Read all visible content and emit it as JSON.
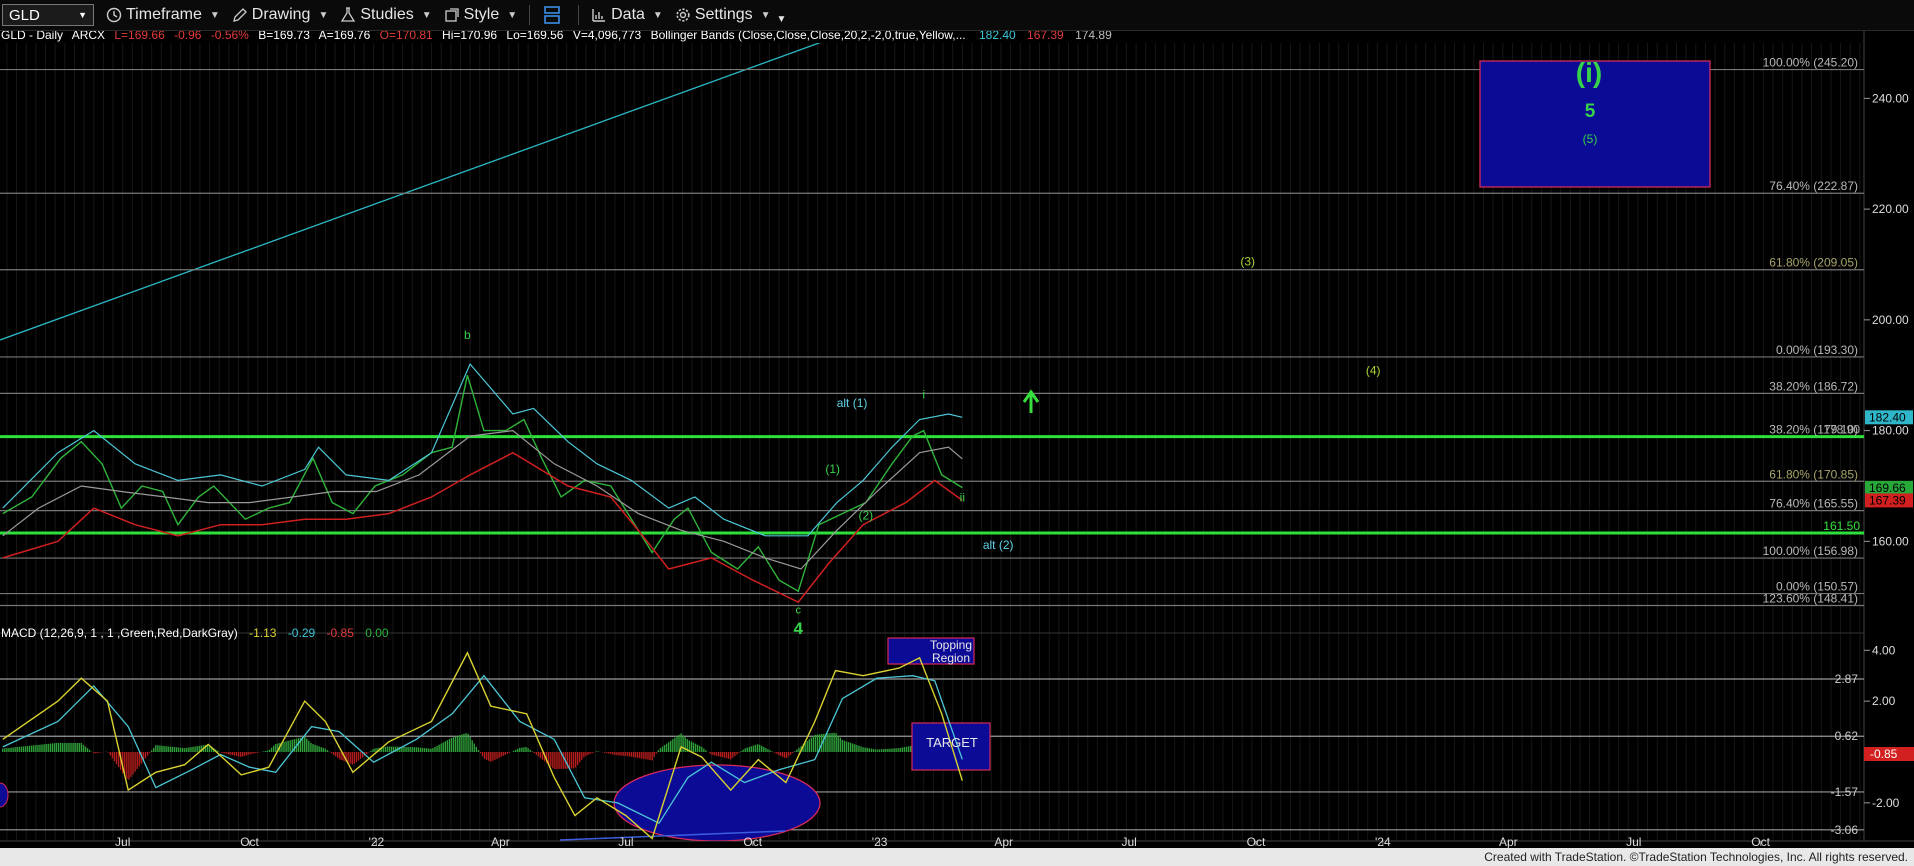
{
  "toolbar": {
    "symbol": "GLD",
    "timeframe": "Timeframe",
    "drawing": "Drawing",
    "studies": "Studies",
    "style": "Style",
    "data": "Data",
    "settings": "Settings"
  },
  "price_panel": {
    "header": {
      "symbol": "GLD - Daily",
      "exchange": "ARCX",
      "last": "L=169.66",
      "change": "-0.96",
      "change_pct": "-0.56%",
      "bid": "B=169.73",
      "ask": "A=169.76",
      "open": "O=170.81",
      "high": "Hi=170.96",
      "low": "Lo=169.56",
      "volume": "V=4,096,773",
      "bb_label": "Bollinger Bands (Close,Close,Close,20,2,-2,0,true,Yellow,...",
      "bb_upper": "182.40",
      "bb_lower": "167.39",
      "bb_mid": "174.89"
    },
    "fib_labels": [
      {
        "text": "100.00% (245.20)",
        "y": 245.2
      },
      {
        "text": "76.40% (222.87)",
        "y": 222.87
      },
      {
        "text": "61.80% (209.05)",
        "y": 209.05
      },
      {
        "text": "0.00% (193.30)",
        "y": 193.3
      },
      {
        "text": "38.20% (186.72)",
        "y": 186.72
      },
      {
        "text": "38.20% (179.10)",
        "y": 178.9
      },
      {
        "text": "61.80% (170.85)",
        "y": 170.85
      },
      {
        "text": "76.40% (165.55)",
        "y": 165.55
      },
      {
        "text": "100.00% (156.98)",
        "y": 156.98
      },
      {
        "text": "0.00% (150.57)",
        "y": 150.57
      },
      {
        "text": "123.60% (148.41)",
        "y": 148.41
      }
    ],
    "support_lines": [
      {
        "text": "178.90",
        "y": 178.9
      },
      {
        "text": "161.50",
        "y": 161.5
      }
    ],
    "axis": {
      "ymin": 142,
      "ymax": 250,
      "ticks": [
        160,
        180,
        200,
        220,
        240
      ]
    },
    "price_tags": [
      {
        "text": "182.40",
        "y": 182.4,
        "bg": "#2fb6c8"
      },
      {
        "text": "169.66",
        "y": 169.66,
        "bg": "#29a83a"
      },
      {
        "text": "167.39",
        "y": 167.39,
        "bg": "#d21f1f"
      }
    ],
    "wave_labels": [
      {
        "text": "b",
        "x": "2022-03-08",
        "y": 196.5,
        "color": "#36d24a",
        "size": 12
      },
      {
        "text": "alt (1)",
        "x": "2022-12-12",
        "y": 184.3,
        "color": "#5fd3e6",
        "size": 12
      },
      {
        "text": "i",
        "x": "2023-02-02",
        "y": 185.8,
        "color": "#36d24a",
        "size": 12
      },
      {
        "text": "(1)",
        "x": "2022-11-28",
        "y": 172.3,
        "color": "#36d24a",
        "size": 12
      },
      {
        "text": "(2)",
        "x": "2022-12-22",
        "y": 163.9,
        "color": "#36d24a",
        "size": 12
      },
      {
        "text": "ii",
        "x": "2023-03-02",
        "y": 167.2,
        "color": "#36d24a",
        "size": 12
      },
      {
        "text": "alt (2)",
        "x": "2023-03-28",
        "y": 158.6,
        "color": "#5fd3e6",
        "size": 12
      },
      {
        "text": "c",
        "x": "2022-11-03",
        "y": 147.0,
        "color": "#36d24a",
        "size": 11
      },
      {
        "text": "4",
        "x": "2022-11-03",
        "y": 143.3,
        "color": "#36d24a",
        "size": 17
      },
      {
        "text": "(3)",
        "x": "2023-09-25",
        "y": 209.8,
        "color": "#a9d232",
        "size": 12
      },
      {
        "text": "(4)",
        "x": "2023-12-25",
        "y": 190.1,
        "color": "#a9d232",
        "size": 12
      }
    ],
    "target_box": {
      "label_top": "(i)",
      "label_mid": "5",
      "label_bottom": "(5)"
    }
  },
  "macd_panel": {
    "header": {
      "label": "MACD (12,26,9, 1 , 1 ,Green,Red,DarkGray)",
      "macd": "-1.13",
      "signal": "-0.29",
      "hist": "-0.85",
      "zero": "0.00"
    },
    "axis": {
      "ymin": -3.5,
      "ymax": 4.6,
      "ticks": [
        4.0,
        2.0,
        0.0,
        -2.0
      ]
    },
    "level_lines": [
      {
        "text": "2.87",
        "y": 2.87
      },
      {
        "text": "0.62",
        "y": 0.62
      },
      {
        "text": "-1.57",
        "y": -1.57
      },
      {
        "text": "-3.06",
        "y": -3.06
      }
    ],
    "value_tag": "-0.85",
    "topping_label": "Topping Region",
    "target_label": "TARGET"
  },
  "time_axis": [
    {
      "text": "Jul",
      "x": "2021-07-01"
    },
    {
      "text": "Oct",
      "x": "2021-10-01"
    },
    {
      "text": "'22",
      "x": "2022-01-01"
    },
    {
      "text": "Apr",
      "x": "2022-04-01"
    },
    {
      "text": "Jul",
      "x": "2022-07-01"
    },
    {
      "text": "Oct",
      "x": "2022-10-01"
    },
    {
      "text": "'23",
      "x": "2023-01-01"
    },
    {
      "text": "Apr",
      "x": "2023-04-01"
    },
    {
      "text": "Jul",
      "x": "2023-07-01"
    },
    {
      "text": "Oct",
      "x": "2023-10-01"
    },
    {
      "text": "'24",
      "x": "2024-01-01"
    },
    {
      "text": "Apr",
      "x": "2024-04-01"
    },
    {
      "text": "Jul",
      "x": "2024-07-01"
    },
    {
      "text": "Oct",
      "x": "2024-10-01"
    }
  ],
  "chart_data": {
    "type": "line",
    "x_domain": [
      "2021-04-03",
      "2024-12-15"
    ],
    "series": [
      {
        "values": [
          [
            "2021-04-05",
            165
          ],
          [
            "2021-04-26",
            168
          ],
          [
            "2021-05-17",
            175
          ],
          [
            "2021-06-01",
            178
          ],
          [
            "2021-06-16",
            174
          ],
          [
            "2021-06-30",
            166
          ],
          [
            "2021-07-15",
            170
          ],
          [
            "2021-07-30",
            169
          ],
          [
            "2021-08-10",
            163
          ],
          [
            "2021-08-25",
            168
          ],
          [
            "2021-09-05",
            170
          ],
          [
            "2021-09-28",
            164
          ],
          [
            "2021-10-15",
            166
          ],
          [
            "2021-10-30",
            167
          ],
          [
            "2021-11-16",
            175
          ],
          [
            "2021-11-30",
            167
          ],
          [
            "2021-12-15",
            165
          ],
          [
            "2021-12-31",
            170
          ],
          [
            "2022-01-20",
            172
          ],
          [
            "2022-02-10",
            176
          ],
          [
            "2022-02-25",
            177
          ],
          [
            "2022-03-08",
            190
          ],
          [
            "2022-03-20",
            180
          ],
          [
            "2022-04-05",
            180
          ],
          [
            "2022-04-18",
            182
          ],
          [
            "2022-05-01",
            175
          ],
          [
            "2022-05-15",
            168
          ],
          [
            "2022-06-01",
            171
          ],
          [
            "2022-06-20",
            170
          ],
          [
            "2022-07-05",
            164
          ],
          [
            "2022-07-20",
            158
          ],
          [
            "2022-08-05",
            164
          ],
          [
            "2022-08-15",
            166
          ],
          [
            "2022-09-01",
            158
          ],
          [
            "2022-09-20",
            155
          ],
          [
            "2022-10-05",
            159
          ],
          [
            "2022-10-20",
            153
          ],
          [
            "2022-11-03",
            151
          ],
          [
            "2022-11-18",
            163
          ],
          [
            "2022-12-05",
            165
          ],
          [
            "2022-12-22",
            167
          ],
          [
            "2023-01-10",
            174
          ],
          [
            "2023-01-25",
            179
          ],
          [
            "2023-02-02",
            180
          ],
          [
            "2023-02-15",
            172
          ],
          [
            "2023-03-02",
            169.7
          ]
        ]
      },
      {
        "values": [
          [
            "2021-04-05",
            161
          ],
          [
            "2021-05-01",
            166
          ],
          [
            "2021-06-01",
            170
          ],
          [
            "2021-06-30",
            169
          ],
          [
            "2021-08-01",
            168
          ],
          [
            "2021-09-01",
            167
          ],
          [
            "2021-10-01",
            167
          ],
          [
            "2021-11-01",
            168
          ],
          [
            "2021-12-01",
            169
          ],
          [
            "2022-01-01",
            169
          ],
          [
            "2022-02-01",
            172
          ],
          [
            "2022-03-10",
            179
          ],
          [
            "2022-04-10",
            180
          ],
          [
            "2022-05-10",
            174
          ],
          [
            "2022-06-10",
            170
          ],
          [
            "2022-07-10",
            165
          ],
          [
            "2022-08-10",
            162
          ],
          [
            "2022-09-10",
            160
          ],
          [
            "2022-10-10",
            157
          ],
          [
            "2022-11-05",
            155
          ],
          [
            "2022-12-01",
            162
          ],
          [
            "2022-12-30",
            169
          ],
          [
            "2023-01-30",
            176
          ],
          [
            "2023-02-20",
            177
          ],
          [
            "2023-03-02",
            174.9
          ]
        ]
      },
      {
        "values": [
          [
            "2021-04-05",
            166
          ],
          [
            "2021-05-15",
            176
          ],
          [
            "2021-06-10",
            180
          ],
          [
            "2021-07-10",
            174
          ],
          [
            "2021-08-10",
            171
          ],
          [
            "2021-09-10",
            172
          ],
          [
            "2021-10-10",
            170
          ],
          [
            "2021-11-10",
            173
          ],
          [
            "2021-11-20",
            177
          ],
          [
            "2021-12-10",
            172
          ],
          [
            "2022-01-10",
            171
          ],
          [
            "2022-02-10",
            176
          ],
          [
            "2022-03-10",
            192
          ],
          [
            "2022-04-10",
            183
          ],
          [
            "2022-04-25",
            184
          ],
          [
            "2022-05-20",
            178
          ],
          [
            "2022-06-10",
            174
          ],
          [
            "2022-07-05",
            171
          ],
          [
            "2022-08-01",
            166
          ],
          [
            "2022-08-20",
            168
          ],
          [
            "2022-09-10",
            164
          ],
          [
            "2022-10-10",
            161
          ],
          [
            "2022-11-10",
            161
          ],
          [
            "2022-12-01",
            167
          ],
          [
            "2022-12-20",
            171
          ],
          [
            "2023-01-10",
            177
          ],
          [
            "2023-01-30",
            182
          ],
          [
            "2023-02-20",
            183
          ],
          [
            "2023-03-02",
            182.4
          ]
        ]
      },
      {
        "values": [
          [
            "2021-04-05",
            157
          ],
          [
            "2021-05-15",
            160
          ],
          [
            "2021-06-10",
            166
          ],
          [
            "2021-07-10",
            163
          ],
          [
            "2021-08-10",
            161
          ],
          [
            "2021-09-10",
            163
          ],
          [
            "2021-10-10",
            163
          ],
          [
            "2021-11-10",
            164
          ],
          [
            "2021-12-10",
            164
          ],
          [
            "2022-01-10",
            165
          ],
          [
            "2022-02-10",
            168
          ],
          [
            "2022-03-10",
            172
          ],
          [
            "2022-04-10",
            176
          ],
          [
            "2022-05-20",
            170
          ],
          [
            "2022-06-20",
            168
          ],
          [
            "2022-07-10",
            162
          ],
          [
            "2022-08-01",
            155
          ],
          [
            "2022-09-01",
            157
          ],
          [
            "2022-10-01",
            153
          ],
          [
            "2022-11-03",
            149
          ],
          [
            "2022-11-25",
            156
          ],
          [
            "2022-12-20",
            163
          ],
          [
            "2023-01-20",
            167
          ],
          [
            "2023-02-10",
            171
          ],
          [
            "2023-03-02",
            167.39
          ]
        ]
      },
      {
        "values": [
          [
            "2021-04-05",
            0.5
          ],
          [
            "2021-05-15",
            2.0
          ],
          [
            "2021-06-01",
            2.9
          ],
          [
            "2021-06-20",
            2.0
          ],
          [
            "2021-07-05",
            -1.5
          ],
          [
            "2021-07-25",
            -0.8
          ],
          [
            "2021-08-15",
            -0.5
          ],
          [
            "2021-09-01",
            0.3
          ],
          [
            "2021-09-25",
            -0.9
          ],
          [
            "2021-10-15",
            -0.6
          ],
          [
            "2021-11-10",
            2.0
          ],
          [
            "2021-11-25",
            1.2
          ],
          [
            "2021-12-15",
            -0.8
          ],
          [
            "2022-01-10",
            0.4
          ],
          [
            "2022-02-10",
            1.2
          ],
          [
            "2022-03-08",
            3.9
          ],
          [
            "2022-03-25",
            1.8
          ],
          [
            "2022-04-20",
            1.5
          ],
          [
            "2022-05-10",
            -1.0
          ],
          [
            "2022-05-25",
            -2.5
          ],
          [
            "2022-06-10",
            -1.8
          ],
          [
            "2022-07-01",
            -2.5
          ],
          [
            "2022-07-20",
            -3.4
          ],
          [
            "2022-08-10",
            0.2
          ],
          [
            "2022-08-25",
            -0.2
          ],
          [
            "2022-09-15",
            -1.5
          ],
          [
            "2022-10-05",
            -0.3
          ],
          [
            "2022-10-25",
            -1.2
          ],
          [
            "2022-11-15",
            1.2
          ],
          [
            "2022-11-30",
            3.2
          ],
          [
            "2022-12-20",
            3.0
          ],
          [
            "2023-01-15",
            3.3
          ],
          [
            "2023-01-30",
            3.7
          ],
          [
            "2023-02-15",
            1.5
          ],
          [
            "2023-03-02",
            -1.13
          ]
        ]
      },
      {
        "values": [
          [
            "2021-04-05",
            0.2
          ],
          [
            "2021-05-15",
            1.2
          ],
          [
            "2021-06-10",
            2.6
          ],
          [
            "2021-07-05",
            1.0
          ],
          [
            "2021-07-25",
            -1.4
          ],
          [
            "2021-08-20",
            -0.7
          ],
          [
            "2021-09-10",
            -0.1
          ],
          [
            "2021-10-01",
            -0.6
          ],
          [
            "2021-10-20",
            -0.8
          ],
          [
            "2021-11-15",
            1.0
          ],
          [
            "2021-12-05",
            0.8
          ],
          [
            "2021-12-30",
            -0.4
          ],
          [
            "2022-01-30",
            0.5
          ],
          [
            "2022-02-25",
            1.5
          ],
          [
            "2022-03-20",
            3.0
          ],
          [
            "2022-04-15",
            1.2
          ],
          [
            "2022-05-10",
            0.5
          ],
          [
            "2022-06-01",
            -1.8
          ],
          [
            "2022-06-25",
            -2.0
          ],
          [
            "2022-07-25",
            -2.8
          ],
          [
            "2022-08-15",
            -1.0
          ],
          [
            "2022-09-01",
            -0.4
          ],
          [
            "2022-09-25",
            -1.2
          ],
          [
            "2022-10-20",
            -0.7
          ],
          [
            "2022-11-15",
            -0.3
          ],
          [
            "2022-12-05",
            2.1
          ],
          [
            "2022-12-30",
            2.9
          ],
          [
            "2023-01-25",
            3.0
          ],
          [
            "2023-02-10",
            2.8
          ],
          [
            "2023-03-02",
            -0.29
          ]
        ]
      }
    ]
  }
}
